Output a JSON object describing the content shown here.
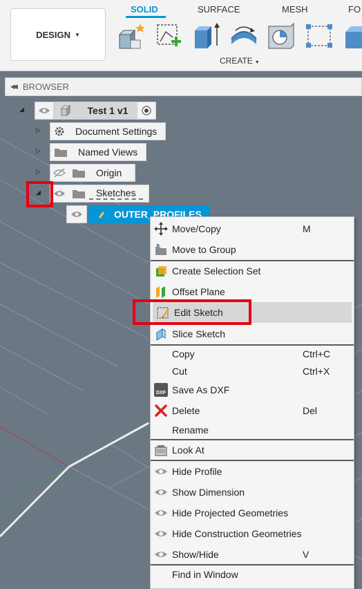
{
  "toolbar": {
    "workspace": "DESIGN",
    "tabs": [
      "SOLID",
      "SURFACE",
      "MESH",
      "FO"
    ],
    "group_label": "CREATE",
    "tools": [
      "new-component-icon",
      "create-sketch-icon",
      "extrude-icon",
      "revolve-icon",
      "hole-icon",
      "pattern-icon",
      "more-icon"
    ]
  },
  "browser": {
    "title": "BROWSER",
    "root": "Test 1 v1",
    "items": [
      "Document Settings",
      "Named Views",
      "Origin",
      "Sketches"
    ],
    "sketch": "OUTER_PROFILES"
  },
  "context_menu": {
    "move_copy": "Move/Copy",
    "move_copy_shortcut": "M",
    "move_to_group": "Move to Group",
    "create_selection_set": "Create Selection Set",
    "offset_plane": "Offset Plane",
    "edit_sketch": "Edit Sketch",
    "slice_sketch": "Slice Sketch",
    "copy": "Copy",
    "copy_shortcut": "Ctrl+C",
    "cut": "Cut",
    "cut_shortcut": "Ctrl+X",
    "save_as_dxf": "Save As DXF",
    "dxf_icon_text": "DXF",
    "delete": "Delete",
    "delete_shortcut": "Del",
    "rename": "Rename",
    "look_at": "Look At",
    "hide_profile": "Hide Profile",
    "show_dimension": "Show Dimension",
    "hide_projected": "Hide Projected Geometries",
    "hide_construction": "Hide Construction Geometries",
    "show_hide": "Show/Hide",
    "show_hide_shortcut": "V",
    "find_in_window": "Find in Window"
  },
  "colors": {
    "accent": "#0696d7",
    "highlight_box": "#e50012",
    "viewport": "#6c7784"
  }
}
